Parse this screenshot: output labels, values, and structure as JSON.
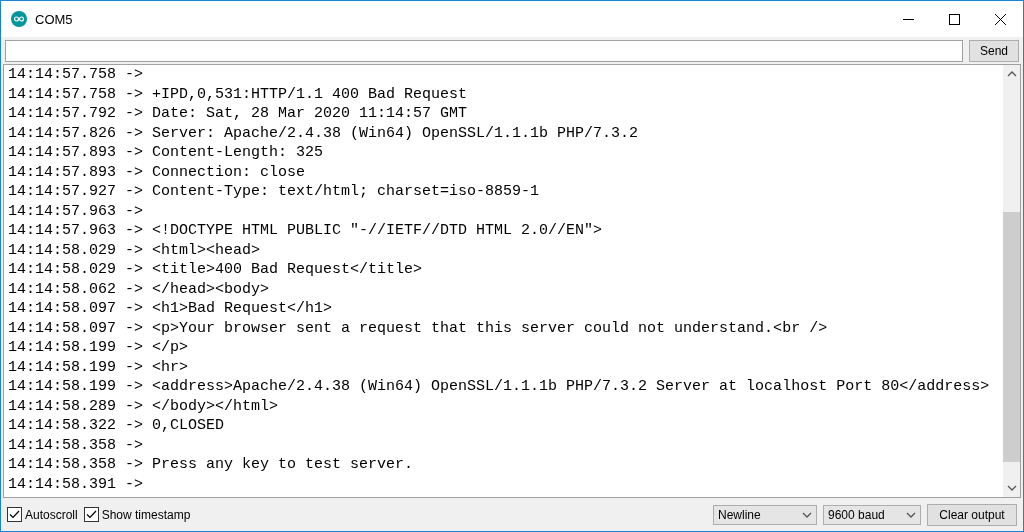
{
  "window": {
    "title": "COM5"
  },
  "input": {
    "button": "Send"
  },
  "output_lines": [
    "14:14:57.758 -> ",
    "14:14:57.758 -> +IPD,0,531:HTTP/1.1 400 Bad Request",
    "14:14:57.792 -> Date: Sat, 28 Mar 2020 11:14:57 GMT",
    "14:14:57.826 -> Server: Apache/2.4.38 (Win64) OpenSSL/1.1.1b PHP/7.3.2",
    "14:14:57.893 -> Content-Length: 325",
    "14:14:57.893 -> Connection: close",
    "14:14:57.927 -> Content-Type: text/html; charset=iso-8859-1",
    "14:14:57.963 -> ",
    "14:14:57.963 -> <!DOCTYPE HTML PUBLIC \"-//IETF//DTD HTML 2.0//EN\">",
    "14:14:58.029 -> <html><head>",
    "14:14:58.029 -> <title>400 Bad Request</title>",
    "14:14:58.062 -> </head><body>",
    "14:14:58.097 -> <h1>Bad Request</h1>",
    "14:14:58.097 -> <p>Your browser sent a request that this server could not understand.<br />",
    "14:14:58.199 -> </p>",
    "14:14:58.199 -> <hr>",
    "14:14:58.199 -> <address>Apache/2.4.38 (Win64) OpenSSL/1.1.1b PHP/7.3.2 Server at localhost Port 80</address>",
    "14:14:58.289 -> </body></html>",
    "14:14:58.322 -> 0,CLOSED",
    "14:14:58.358 -> ",
    "14:14:58.358 -> Press any key to test server.",
    "14:14:58.391 -> "
  ],
  "options": [
    {
      "label": "Autoscroll",
      "checked": true
    },
    {
      "label": "Show timestamp",
      "checked": true
    }
  ],
  "line_ending": "Newline",
  "baud": "9600 baud",
  "clear_button": "Clear output"
}
